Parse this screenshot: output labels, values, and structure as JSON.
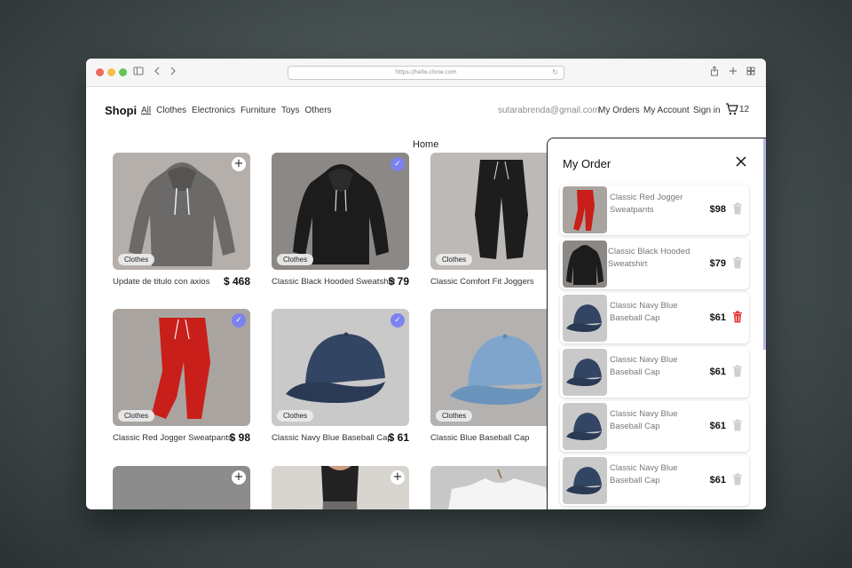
{
  "browser": {
    "url": "https://hello-clone.com"
  },
  "nav": {
    "brand": "Shopi",
    "categories": [
      "All",
      "Clothes",
      "Electronics",
      "Furniture",
      "Toys",
      "Others"
    ],
    "active_category": "All",
    "user_email": "sutarabrenda@gmail.com",
    "my_orders": "My Orders",
    "my_account": "My Account",
    "sign_in": "Sign in",
    "cart_count": "12"
  },
  "page": {
    "heading": "Home"
  },
  "products": [
    {
      "title": "Update de titulo con axios",
      "price": "$ 468",
      "category": "Clothes",
      "state": "add",
      "image": "gray-hoodie"
    },
    {
      "title": "Classic Black Hooded Sweatshirt",
      "price": "$ 79",
      "category": "Clothes",
      "state": "added",
      "image": "black-hoodie"
    },
    {
      "title": "Classic Comfort Fit Joggers",
      "price": "",
      "category": "Clothes",
      "state": "none",
      "image": "black-joggers"
    },
    {
      "title": "Classic Red Jogger Sweatpants",
      "price": "$ 98",
      "category": "Clothes",
      "state": "added",
      "image": "red-joggers"
    },
    {
      "title": "Classic Navy Blue Baseball Cap",
      "price": "$ 61",
      "category": "Clothes",
      "state": "added",
      "image": "navy-cap"
    },
    {
      "title": "Classic Blue Baseball Cap",
      "price": "",
      "category": "Clothes",
      "state": "none",
      "image": "blue-cap"
    },
    {
      "title": "",
      "price": "",
      "category": "",
      "state": "add",
      "image": "gray-blank"
    },
    {
      "title": "",
      "price": "",
      "category": "",
      "state": "add",
      "image": "black-top"
    },
    {
      "title": "",
      "price": "",
      "category": "",
      "state": "none",
      "image": "white-tee"
    }
  ],
  "order_panel": {
    "title": "My Order",
    "items": [
      {
        "title": "Classic Red Jogger Sweatpants",
        "price": "$98",
        "image": "red-joggers",
        "trash_color": "#cfcfcf"
      },
      {
        "title": "Classic Black Hooded Sweatshirt",
        "price": "$79",
        "image": "black-hoodie",
        "trash_color": "#cfcfcf"
      },
      {
        "title": "Classic Navy Blue Baseball Cap",
        "price": "$61",
        "image": "navy-cap",
        "trash_color": "#e53935"
      },
      {
        "title": "Classic Navy Blue Baseball Cap",
        "price": "$61",
        "image": "navy-cap",
        "trash_color": "#cfcfcf"
      },
      {
        "title": "Classic Navy Blue Baseball Cap",
        "price": "$61",
        "image": "navy-cap",
        "trash_color": "#cfcfcf"
      },
      {
        "title": "Classic Navy Blue Baseball Cap",
        "price": "$61",
        "image": "navy-cap",
        "trash_color": "#cfcfcf"
      }
    ]
  },
  "colors": {
    "accent": "#7c83ef",
    "danger": "#e53935"
  }
}
